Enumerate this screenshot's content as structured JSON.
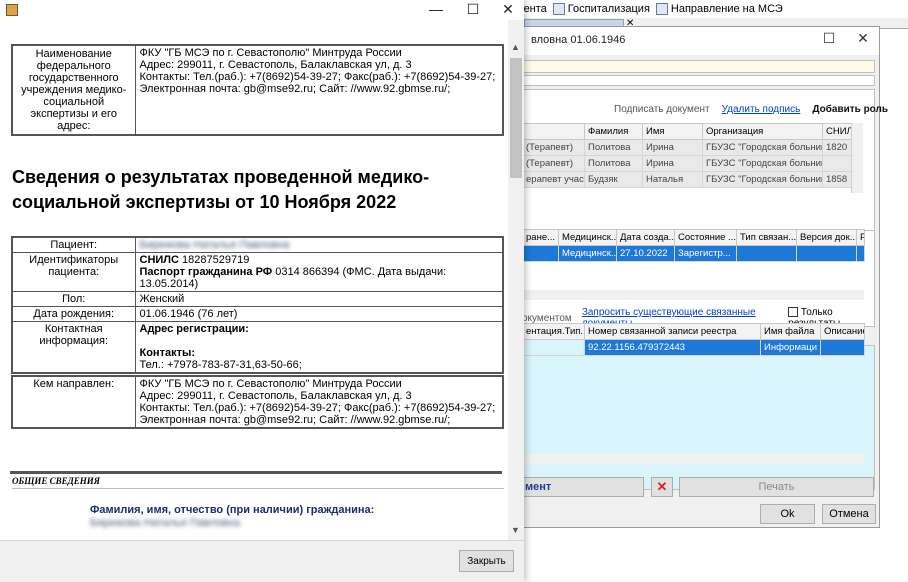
{
  "topbar": {
    "item1": "мента",
    "item2": "Госпитализация",
    "item3": "Направление на МСЭ"
  },
  "right_dialog": {
    "title": "вловна 01.06.1946",
    "links": {
      "sign": "Подписать документ",
      "delete_sign": "Удалить подпись",
      "add_role": "Добавить роль"
    },
    "signers_table": {
      "headers": [
        "",
        "Фамилия",
        "Имя",
        "Организация",
        "СНИЛ"
      ],
      "rows": [
        [
          "(Терапевт)",
          "Политова",
          "Ирина",
          "ГБУЗС \"Городская больниц...",
          "1820"
        ],
        [
          "(Терапевт)",
          "Политова",
          "Ирина",
          "ГБУЗС \"Городская больниц...",
          ""
        ],
        [
          "ерапевт участ...",
          "Будзяк",
          "Наталья",
          "ГБУЗС \"Городская больниц...",
          "1858"
        ]
      ]
    },
    "docs_table": {
      "headers": [
        "ране...",
        "Медицинск...",
        "Дата созда...",
        "Состояние ...",
        "Тип связан...",
        "Версия док...",
        "Р"
      ],
      "rows": [
        [
          "",
          "Медицинск...",
          "27.10.2022",
          "Зарегистр...",
          "",
          "",
          ""
        ]
      ]
    },
    "related_bar": {
      "label": "окументом",
      "request_link": "Запросить существующие связанные документы",
      "only_results": "Только результаты"
    },
    "related_table": {
      "headers": [
        "ентация.Тип...",
        "Номер связанной записи реестра",
        "Имя файла",
        "Описание"
      ],
      "rows": [
        [
          "",
          "92.22.1156.479372443",
          "Информаци",
          ""
        ]
      ]
    },
    "buttons": {
      "document": "мент",
      "delete_icon": "✕",
      "print": "Печать",
      "ok": "Ok",
      "cancel": "Отмена"
    }
  },
  "doc_window": {
    "controls": {
      "minimize": "—",
      "maximize": "☐",
      "close": "✕"
    },
    "org_block": {
      "label": "Наименование федерального государственного учреждения медико-социальной экспертизы и его адрес:",
      "lines": [
        "ФКУ \"ГБ МСЭ по г. Севастополю\" Минтруда России",
        "Адрес: 299011, г. Севастополь, Балаклавская ул, д. 3",
        "Контакты: Тел.(раб.): +7(8692)54-39-27; Факс(раб.): +7(8692)54-39-27;",
        "Электронная почта: gb@mse92.ru; Сайт: //www.92.gbmse.ru/;"
      ]
    },
    "heading": "Сведения о результатах проведенной медико-социальной экспертизы от 10 Ноября 2022",
    "patient": {
      "patient_label": "Пациент:",
      "patient_value": "Бирюкова Наталья Павловна",
      "ids_label": "Идентификаторы пациента:",
      "snils_label": "СНИЛС",
      "snils_value": "18287529719",
      "passport_label": "Паспорт гражданина РФ",
      "passport_value": "0314 866394 (ФМС. Дата выдачи: 13.05.2014)",
      "sex_label": "Пол:",
      "sex_value": "Женский",
      "dob_label": "Дата рождения:",
      "dob_value": "01.06.1946 (76 лет)",
      "contact_label": "Контактная информация:",
      "reg_address_label": "Адрес регистрации:",
      "contacts_label": "Контакты:",
      "contacts_value": "Тел.: +7978-783-87-31,63-50-66;"
    },
    "referred": {
      "label": "Кем направлен:",
      "lines": [
        "ФКУ \"ГБ МСЭ по г. Севастополю\" Минтруда России",
        "Адрес: 299011, г. Севастополь, Балаклавская ул, д. 3",
        "Контакты: Тел.(раб.): +7(8692)54-39-27; Факс(раб.): +7(8692)54-39-27;",
        "Электронная почта: gb@mse92.ru; Сайт: //www.92.gbmse.ru/;"
      ]
    },
    "section_title": "ОБЩИЕ СВЕДЕНИЯ",
    "fio_label": "Фамилия, имя, отчество (при наличии) гражданина:",
    "fio_value": "Бирюкова Наталья Павловна",
    "close_button": "Закрыть"
  }
}
